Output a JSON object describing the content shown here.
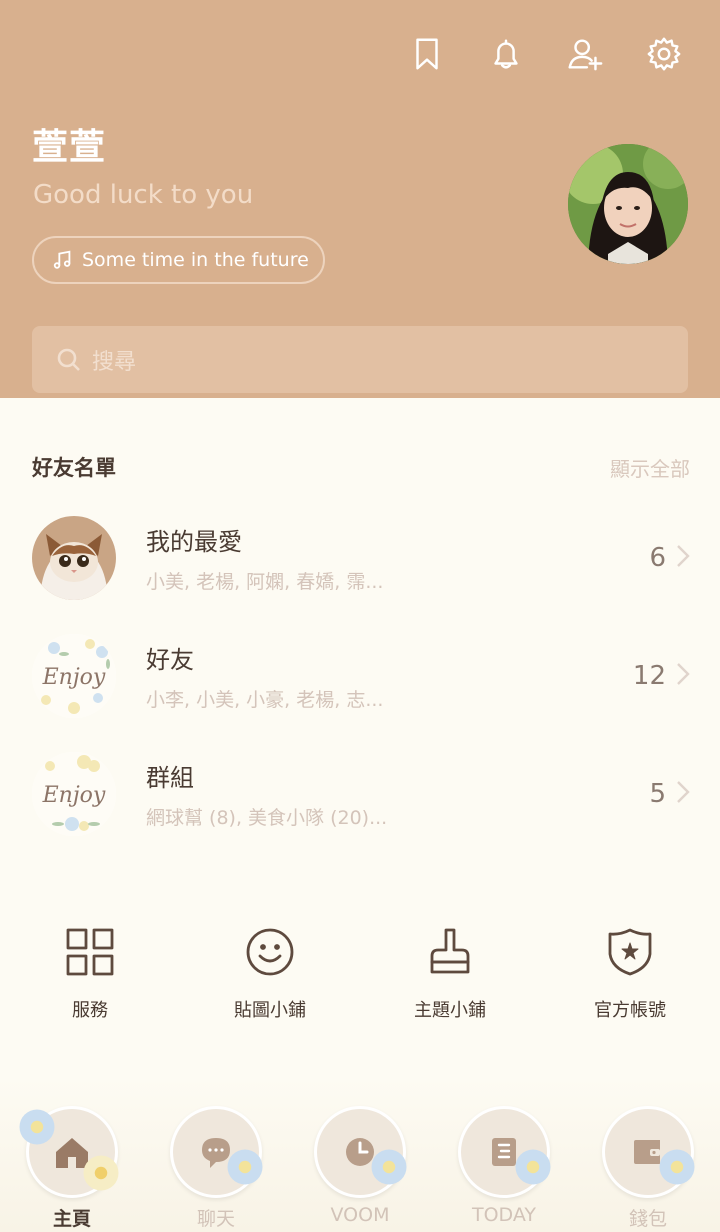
{
  "profile": {
    "name": "萱萱",
    "status": "Good luck to you",
    "music": "Some time in the future"
  },
  "search": {
    "placeholder": "搜尋"
  },
  "friends_section": {
    "title": "好友名單",
    "show_all": "顯示全部",
    "rows": [
      {
        "name": "我的最愛",
        "members": "小美, 老楊, 阿嫻, 春嬌, 霈...",
        "count": "6"
      },
      {
        "name": "好友",
        "members": "小李, 小美, 小豪, 老楊, 志...",
        "count": "12"
      },
      {
        "name": "群組",
        "members": "網球幫 (8), 美食小隊 (20)...",
        "count": "5"
      }
    ]
  },
  "services": [
    {
      "label": "服務",
      "icon": "grid-icon"
    },
    {
      "label": "貼圖小鋪",
      "icon": "smiley-icon"
    },
    {
      "label": "主題小鋪",
      "icon": "brush-icon"
    },
    {
      "label": "官方帳號",
      "icon": "shield-star-icon"
    }
  ],
  "bottom_nav": [
    {
      "label": "主頁",
      "icon": "home-icon",
      "active": true
    },
    {
      "label": "聊天",
      "icon": "chat-icon",
      "active": false
    },
    {
      "label": "VOOM",
      "icon": "clock-icon",
      "active": false
    },
    {
      "label": "TODAY",
      "icon": "news-icon",
      "active": false
    },
    {
      "label": "錢包",
      "icon": "wallet-icon",
      "active": false
    }
  ],
  "top_icons": [
    "bookmark-icon",
    "bell-icon",
    "add-friend-icon",
    "settings-icon"
  ],
  "colors": {
    "header": "#d8b08e",
    "background": "#fdfbf3",
    "text": "#4a3b32"
  }
}
